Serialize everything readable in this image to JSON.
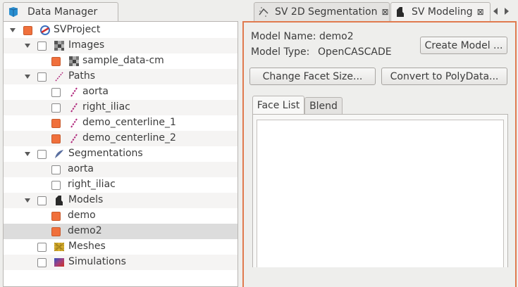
{
  "data_manager": {
    "tab_title": "Data Manager",
    "items": [
      {
        "label": "SVProject"
      },
      {
        "label": "Images"
      },
      {
        "label": "sample_data-cm"
      },
      {
        "label": "Paths"
      },
      {
        "label": "aorta"
      },
      {
        "label": "right_iliac"
      },
      {
        "label": "demo_centerline_1"
      },
      {
        "label": "demo_centerline_2"
      },
      {
        "label": "Segmentations"
      },
      {
        "label": "aorta"
      },
      {
        "label": "right_iliac"
      },
      {
        "label": "Models"
      },
      {
        "label": "demo"
      },
      {
        "label": "demo2"
      },
      {
        "label": "Meshes"
      },
      {
        "label": "Simulations"
      }
    ]
  },
  "editor_tabs": {
    "tab1": "SV 2D Segmentation",
    "tab2": "SV Modeling",
    "close_glyph": "⊠"
  },
  "modeling": {
    "model_name_label": "Model Name:",
    "model_name_value": "demo2",
    "model_type_label": "Model Type:",
    "model_type_value": "OpenCASCADE",
    "create_model_button": "Create Model ...",
    "change_facet_button": "Change Facet Size...",
    "convert_button": "Convert to PolyData...",
    "subtabs": [
      "Face List",
      "Blend"
    ]
  },
  "colors": {
    "accent": "#e07a4e",
    "checked_box": "#f0703c",
    "path_icon": "#b0287c"
  }
}
